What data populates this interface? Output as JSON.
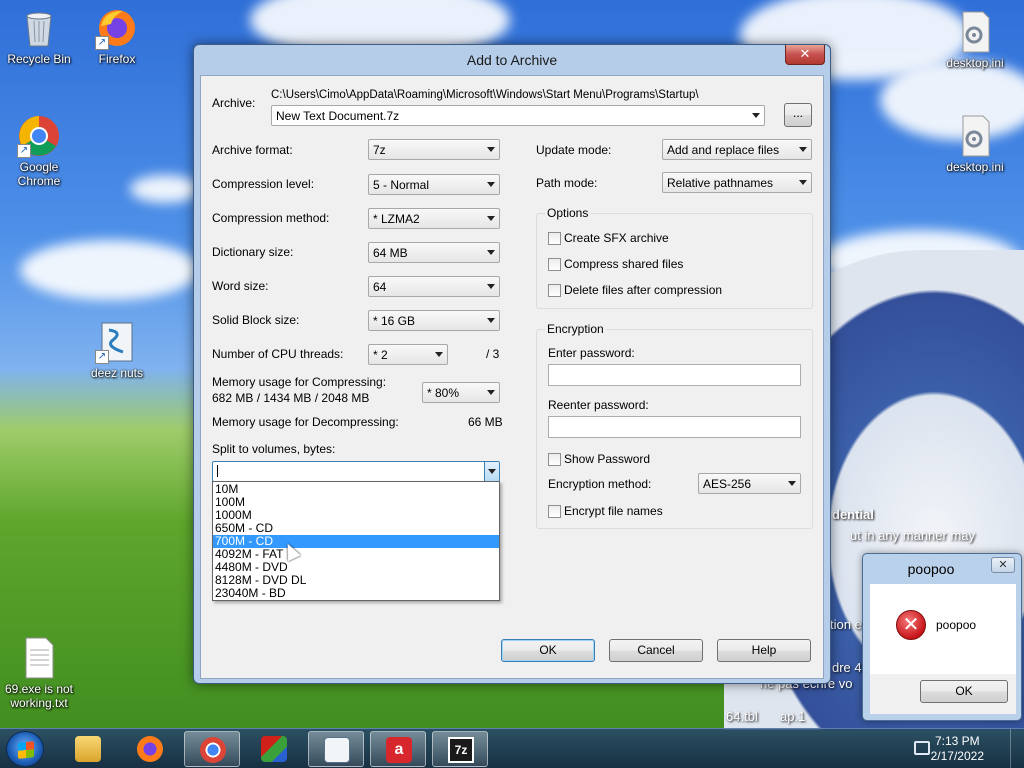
{
  "desktop": {
    "icons": [
      {
        "label": "Recycle Bin",
        "icon": "recycle-bin-icon"
      },
      {
        "label": "Firefox",
        "icon": "firefox-icon"
      },
      {
        "label": "Google Chrome",
        "icon": "chrome-icon"
      },
      {
        "label": "deez nuts",
        "icon": "script-icon"
      },
      {
        "label": "69.exe is not working.txt",
        "icon": "text-file-icon"
      },
      {
        "label": "desktop.ini",
        "icon": "settings-file-icon"
      },
      {
        "label": "desktop.ini",
        "icon": "settings-file-icon"
      }
    ],
    "background_text": [
      "dential",
      "ut in any manner may",
      "tion e",
      "dre 4",
      "ne pas écrire vo",
      "64.tbl",
      "ap.1"
    ]
  },
  "dialog": {
    "title": "Add to Archive",
    "close_glyph": "✕",
    "archive_label": "Archive:",
    "archive_path": "C:\\Users\\Cimo\\AppData\\Roaming\\Microsoft\\Windows\\Start Menu\\Programs\\Startup\\",
    "archive_name": "New Text Document.7z",
    "browse_label": "...",
    "left_fields": [
      {
        "label": "Archive format:",
        "value": "7z"
      },
      {
        "label": "Compression level:",
        "value": "5 - Normal"
      },
      {
        "label": "Compression method:",
        "value": "* LZMA2"
      },
      {
        "label": "Dictionary size:",
        "value": "64 MB"
      },
      {
        "label": "Word size:",
        "value": "64"
      },
      {
        "label": "Solid Block size:",
        "value": "* 16 GB"
      }
    ],
    "cpu_threads_label": "Number of CPU threads:",
    "cpu_threads_value": "* 2",
    "cpu_threads_max": "/ 3",
    "mem_compress_label": "Memory usage for Compressing:",
    "mem_compress_values": "682 MB / 1434 MB / 2048 MB",
    "mem_compress_percent": "* 80%",
    "mem_decompress_label": "Memory usage for Decompressing:",
    "mem_decompress_value": "66 MB",
    "split_label": "Split to volumes, bytes:",
    "split_value": "",
    "split_options": [
      "10M",
      "100M",
      "1000M",
      "650M - CD",
      "700M - CD",
      "4092M - FAT",
      "4480M - DVD",
      "8128M - DVD DL",
      "23040M - BD"
    ],
    "split_selected_index": 4,
    "update_mode_label": "Update mode:",
    "update_mode_value": "Add and replace files",
    "path_mode_label": "Path mode:",
    "path_mode_value": "Relative pathnames",
    "options": {
      "legend": "Options",
      "items": [
        {
          "label": "Create SFX archive",
          "checked": false
        },
        {
          "label": "Compress shared files",
          "checked": false
        },
        {
          "label": "Delete files after compression",
          "checked": false
        }
      ]
    },
    "encryption": {
      "legend": "Encryption",
      "enter_password_label": "Enter password:",
      "reenter_password_label": "Reenter password:",
      "show_password_label": "Show Password",
      "method_label": "Encryption method:",
      "method_value": "AES-256",
      "encrypt_names_label": "Encrypt file names"
    },
    "buttons": {
      "ok": "OK",
      "cancel": "Cancel",
      "help": "Help"
    }
  },
  "message_box": {
    "title": "poopoo",
    "close_glyph": "✕",
    "message": "poopoo",
    "icon_glyph": "✕",
    "ok": "OK"
  },
  "taskbar": {
    "time": "7:13 PM",
    "date": "2/17/2022",
    "apps": [
      "file-explorer-icon",
      "firefox-icon",
      "chrome-icon",
      "app-installer-icon",
      "script-icon",
      "avira-icon",
      "7zip-icon"
    ],
    "seven_zip_glyph": "7z",
    "avira_glyph": "a"
  }
}
